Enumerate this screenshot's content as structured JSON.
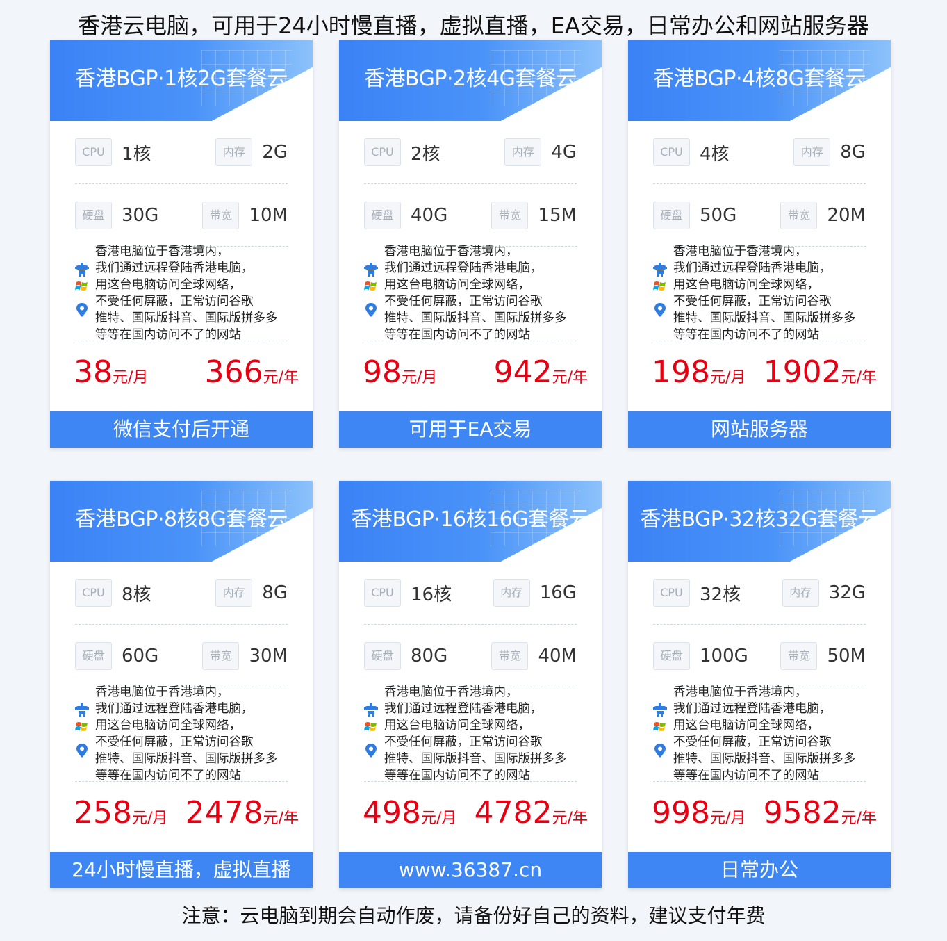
{
  "page_title": "香港云电脑，可用于24小时慢直播，虚拟直播，EA交易，日常办公和网站服务器",
  "footer_note": "注意：云电脑到期会自动作废，请备份好自己的资料，建议支付年费",
  "labels": {
    "cpu": "CPU",
    "memory": "内存",
    "disk": "硬盘",
    "bandwidth": "带宽"
  },
  "description": [
    "香港电脑位于香港境内，",
    "我们通过远程登陆香港电脑，",
    "用这台电脑访问全球网络，",
    "不受任何屏蔽，正常访问谷歌",
    "推特、国际版抖音、国际版拼多多",
    "等等在国内访问不了的网站"
  ],
  "icons": [
    "robot-icon",
    "windows-icon",
    "location-pin-icon"
  ],
  "colors": {
    "header_blue": "#3b82f6",
    "footer_blue": "#3d86f3",
    "price_red": "#e60012"
  },
  "plans": [
    {
      "title": "香港BGP·1核2G套餐云",
      "cpu": "1核",
      "memory": "2G",
      "disk": "30G",
      "bandwidth": "10M",
      "price_month": "38",
      "month_unit": "元/月",
      "price_year": "366",
      "year_unit": "元/年",
      "footer": "微信支付后开通"
    },
    {
      "title": "香港BGP·2核4G套餐云",
      "cpu": "2核",
      "memory": "4G",
      "disk": "40G",
      "bandwidth": "15M",
      "price_month": "98",
      "month_unit": "元/月",
      "price_year": "942",
      "year_unit": "元/年",
      "footer": "可用于EA交易"
    },
    {
      "title": "香港BGP·4核8G套餐云",
      "cpu": "4核",
      "memory": "8G",
      "disk": "50G",
      "bandwidth": "20M",
      "price_month": "198",
      "month_unit": "元/月",
      "price_year": "1902",
      "year_unit": "元/年",
      "footer": "网站服务器"
    },
    {
      "title": "香港BGP·8核8G套餐云",
      "cpu": "8核",
      "memory": "8G",
      "disk": "60G",
      "bandwidth": "30M",
      "price_month": "258",
      "month_unit": "元/月",
      "price_year": "2478",
      "year_unit": "元/年",
      "footer": "24小时慢直播，虚拟直播"
    },
    {
      "title": "香港BGP·16核16G套餐云",
      "cpu": "16核",
      "memory": "16G",
      "disk": "80G",
      "bandwidth": "40M",
      "price_month": "498",
      "month_unit": "元/月",
      "price_year": "4782",
      "year_unit": "元/年",
      "footer": "www.36387.cn"
    },
    {
      "title": "香港BGP·32核32G套餐云",
      "cpu": "32核",
      "memory": "32G",
      "disk": "100G",
      "bandwidth": "50M",
      "price_month": "998",
      "month_unit": "元/月",
      "price_year": "9582",
      "year_unit": "元/年",
      "footer": "日常办公"
    }
  ]
}
